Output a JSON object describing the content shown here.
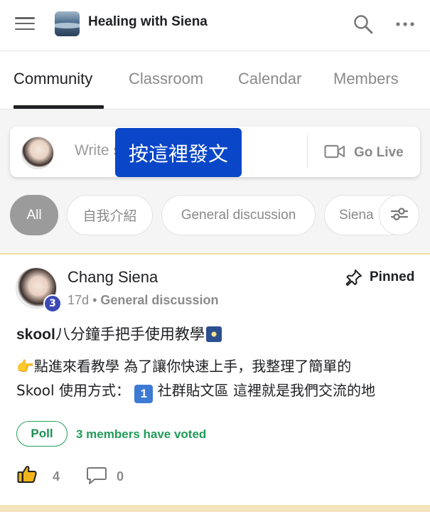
{
  "header": {
    "group_name": "Healing with Siena",
    "icons": [
      "hamburger-menu-icon",
      "group-logo",
      "search-icon",
      "more-icon"
    ]
  },
  "tabs": [
    {
      "label": "Community",
      "active": true
    },
    {
      "label": "Classroom",
      "active": false
    },
    {
      "label": "Calendar",
      "active": false
    },
    {
      "label": "Members",
      "active": false
    }
  ],
  "composer": {
    "placeholder": "Write s",
    "overlay_tip": "按這裡發文",
    "go_live_label": "Go Live"
  },
  "filters": {
    "chips": [
      {
        "label": "All",
        "active": true
      },
      {
        "label": "自我介紹",
        "active": false
      },
      {
        "label": "General discussion",
        "active": false
      },
      {
        "label": "Siena",
        "active": false
      }
    ]
  },
  "post": {
    "author": "Chang Siena",
    "level": "3",
    "age": "17d",
    "separator": "•",
    "category": "General discussion",
    "pinned_label": "Pinned",
    "title_brand": "skool",
    "title_rest": "八分鐘手把手使用教學",
    "body_hand": "👉",
    "body_line1": "點進來看教學 為了讓你快速上手，我整理了簡單的",
    "body_line2_a": "Skool 使用方式：",
    "body_line2_badge": "1",
    "body_line2_b": " 社群貼文區 這裡就是我們交流的地",
    "poll_label": "Poll",
    "votes_text": "3 members have voted",
    "likes": "4",
    "comments": "0"
  },
  "colors": {
    "accent_blue": "#0a46c8",
    "poll_green": "#21a05c",
    "level_badge": "#3b4ab5",
    "pinned_border": "#f6dda6"
  }
}
